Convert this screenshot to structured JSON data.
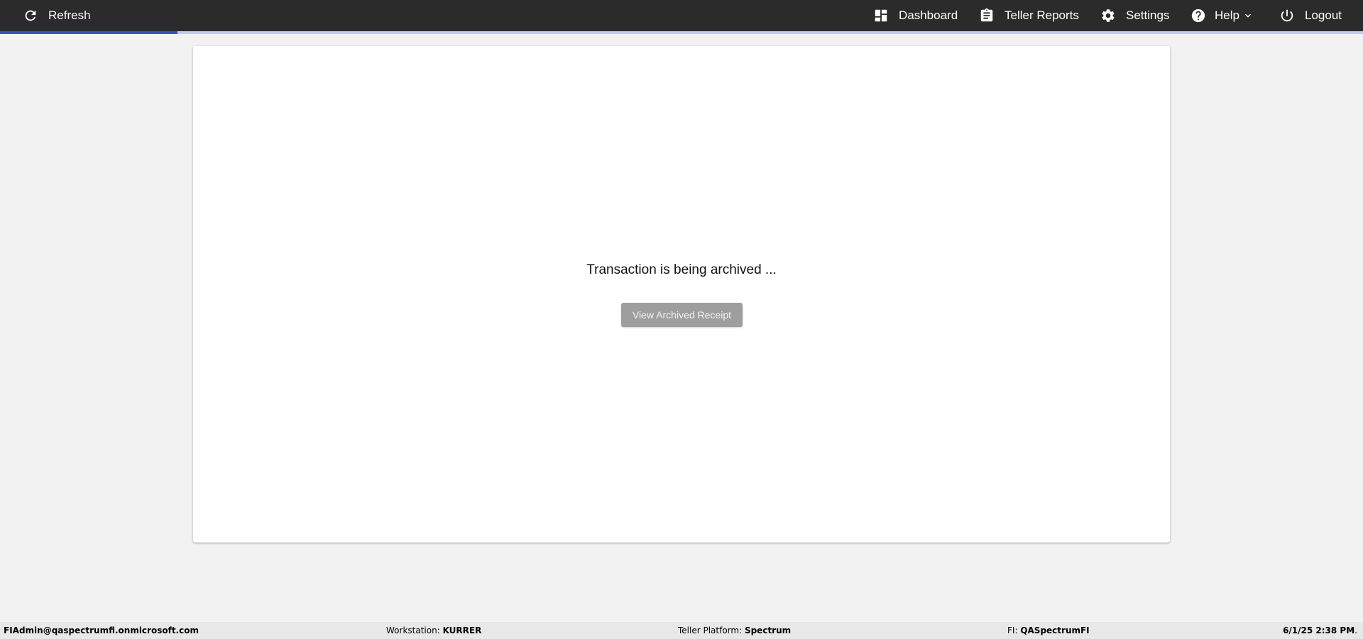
{
  "toolbar": {
    "refresh_label": "Refresh",
    "nav": [
      {
        "label": "Dashboard",
        "icon": "dashboard-icon"
      },
      {
        "label": "Teller Reports",
        "icon": "clipboard-icon"
      },
      {
        "label": "Settings",
        "icon": "gear-icon"
      },
      {
        "label": "Help",
        "icon": "help-circle-icon"
      },
      {
        "label": "Logout",
        "icon": "power-icon"
      }
    ],
    "loading_progress_fraction": 0.13
  },
  "main": {
    "status_message": "Transaction is being archived ...",
    "view_receipt_label": "View Archived Receipt"
  },
  "footer": {
    "user": "FIAdmin@qaspectrumfi.onmicrosoft.com",
    "workstation_label": "Workstation:",
    "workstation_value": "KURRER",
    "platform_label": "Teller Platform:",
    "platform_value": "Spectrum",
    "fi_label": "FI:",
    "fi_value": "QASpectrumFI",
    "datetime": "6/1/25 2:38 PM",
    "datetime_suffix": "."
  },
  "colors": {
    "topbar_bg": "#2b2b2b",
    "progress_accent": "#3f51b5",
    "page_bg": "#f2f2f2",
    "disabled_button": "#9e9e9e"
  }
}
